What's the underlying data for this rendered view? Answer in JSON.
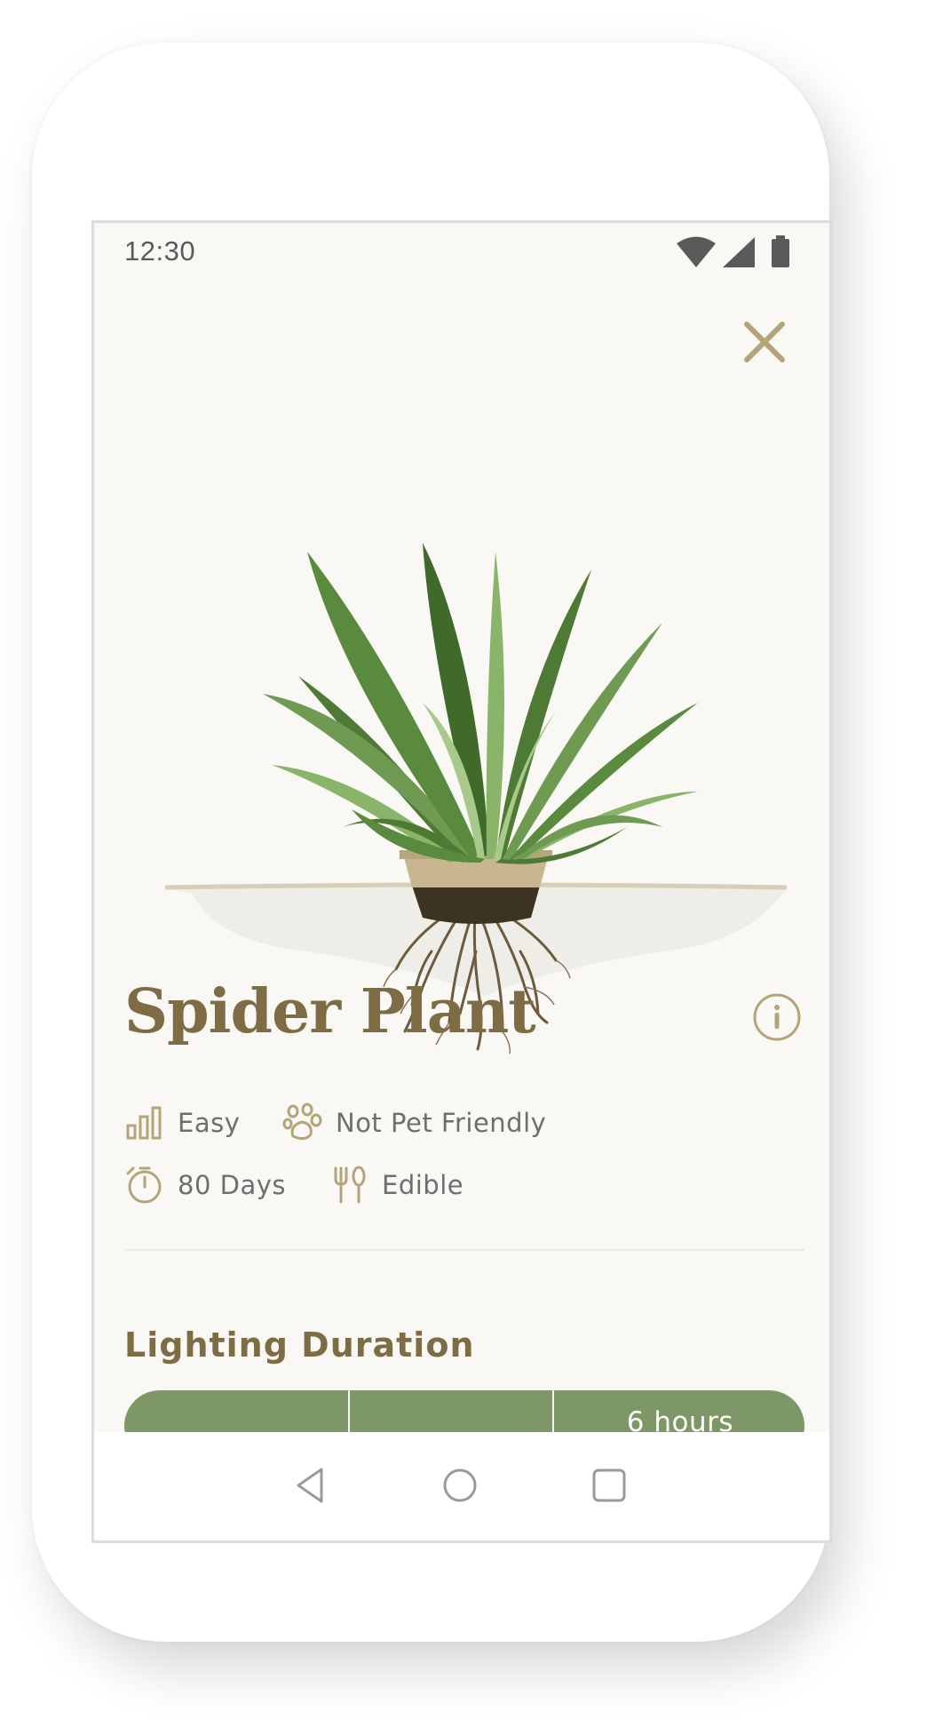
{
  "status": {
    "time": "12:30",
    "icons": [
      "wifi-icon",
      "cellular-signal-icon",
      "battery-icon"
    ]
  },
  "plant": {
    "name": "Spider Plant",
    "illustration": "spider-plant-with-roots"
  },
  "attributes": [
    {
      "icon": "difficulty-bars-icon",
      "label": "Easy"
    },
    {
      "icon": "paw-icon",
      "label": "Not Pet Friendly"
    },
    {
      "icon": "timer-icon",
      "label": "80 Days"
    },
    {
      "icon": "fork-knife-icon",
      "label": "Edible"
    }
  ],
  "lighting": {
    "title": "Lighting Duration",
    "value_label": "6 hours"
  },
  "navigation": {
    "buttons": [
      "back-icon",
      "home-icon",
      "recents-icon"
    ]
  },
  "colors": {
    "brand": "#7e6c45",
    "accent": "#b5a47a",
    "bar_green": "#7d9866",
    "screen_bg": "#f9f8f5"
  }
}
